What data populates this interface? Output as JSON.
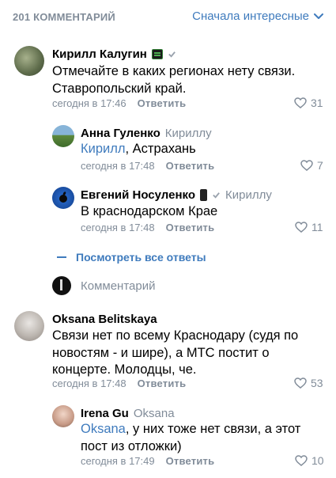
{
  "header": {
    "count": "201 КОММЕНТАРИЙ",
    "sort_label": "Сначала интересные"
  },
  "comments": [
    {
      "author": "Кирилл Калугин",
      "reply_to": "",
      "mention": "",
      "text": "Отмечайте в каких регионах нету связи. Ставропольский край.",
      "time": "сегодня в 17:46",
      "reply_label": "Ответить",
      "likes": "31"
    },
    {
      "author": "Анна Гуленко",
      "reply_to": "Кириллу",
      "mention": "Кирилл",
      "text": ", Астрахань",
      "time": "сегодня в 17:48",
      "reply_label": "Ответить",
      "likes": "7"
    },
    {
      "author": "Евгений Носуленко",
      "reply_to": "Кириллу",
      "mention": "",
      "text": "В краснодарском Крае",
      "time": "сегодня в 17:48",
      "reply_label": "Ответить",
      "likes": "11"
    },
    {
      "author": "Oksana Belitskaya",
      "reply_to": "",
      "mention": "",
      "text": "Связи нет по всему Краснодару (судя по новостям - и шире), а МТС постит о концерте. Молодцы, че.",
      "time": "сегодня в 17:48",
      "reply_label": "Ответить",
      "likes": "53"
    },
    {
      "author": "Irena Gu",
      "reply_to": "Oksana",
      "mention": "Oksana",
      "text": ", у них тоже нет связи, а этот пост из отложки)",
      "time": "сегодня в 17:49",
      "reply_label": "Ответить",
      "likes": "10"
    }
  ],
  "show_all": "Посмотреть все ответы",
  "compose_placeholder": "Комментарий",
  "colors": {
    "accent": "#3f7bbd",
    "muted": "#818c99"
  }
}
